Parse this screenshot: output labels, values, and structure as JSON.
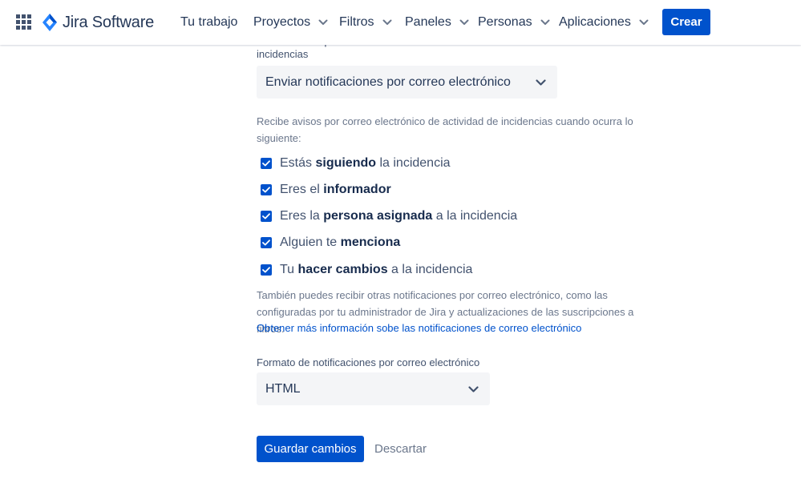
{
  "header": {
    "app_name": "Jira Software",
    "nav": [
      {
        "label": "Tu trabajo",
        "has_dropdown": false
      },
      {
        "label": "Proyectos",
        "has_dropdown": true
      },
      {
        "label": "Filtros",
        "has_dropdown": true
      },
      {
        "label": "Paneles",
        "has_dropdown": true
      },
      {
        "label": "Personas",
        "has_dropdown": true
      },
      {
        "label": "Aplicaciones",
        "has_dropdown": true
      }
    ],
    "create_label": "Crear",
    "brand_color": "#0052cc"
  },
  "notifications": {
    "label": "Notificaciones por correo electrónico sobre la actividad de incidencias",
    "select_value": "Enviar notificaciones por correo electrónico",
    "description": "Recibe avisos por correo electrónico de actividad de incidencias cuando ocurra lo siguiente:",
    "options": [
      {
        "before": "Estás ",
        "bold": "siguiendo",
        "after": " la incidencia",
        "checked": true
      },
      {
        "before": "Eres el ",
        "bold": "informador",
        "after": "",
        "checked": true
      },
      {
        "before": "Eres la ",
        "bold": "persona asignada",
        "after": " a la incidencia",
        "checked": true
      },
      {
        "before": "Alguien te ",
        "bold": "menciona",
        "after": "",
        "checked": true
      },
      {
        "before": "Tu ",
        "bold": "hacer cambios",
        "after": " a la incidencia",
        "checked": true
      }
    ],
    "extra_text": "También puedes recibir otras notificaciones por correo electrónico, como las configuradas por tu administrador de Jira y actualizaciones de las suscripciones a filtros.",
    "learn_more_link": "Obtener más información sobe las notificaciones de correo electrónico"
  },
  "format": {
    "label": "Formato de notificaciones por correo electrónico",
    "select_value": "HTML"
  },
  "actions": {
    "save_label": "Guardar cambios",
    "discard_label": "Descartar"
  }
}
